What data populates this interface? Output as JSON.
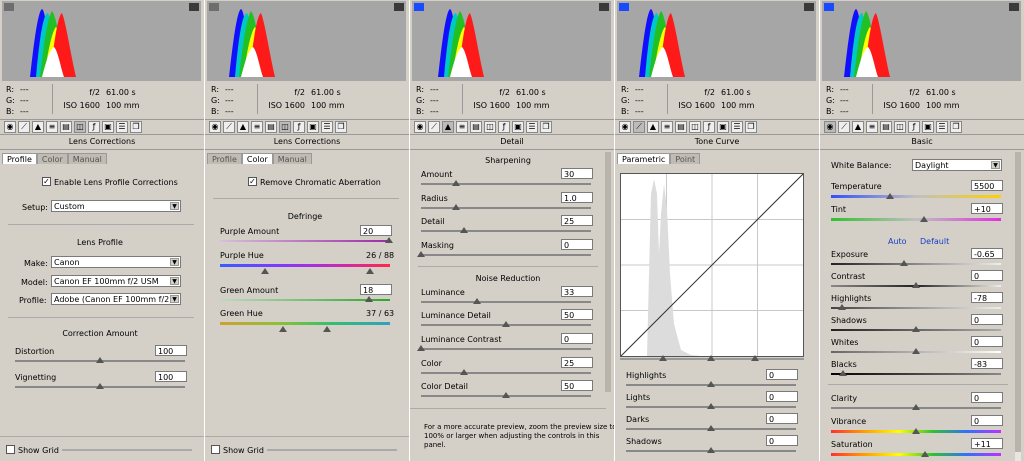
{
  "common": {
    "r_label": "R:",
    "g_label": "G:",
    "b_label": "B:",
    "dash": "---",
    "aperture": "f/2",
    "shutter": "61.00 s",
    "iso": "ISO 1600",
    "focal": "100 mm"
  },
  "lens_profile": {
    "title": "Lens Corrections",
    "tabs": [
      "Profile",
      "Color",
      "Manual"
    ],
    "enable_label": "Enable Lens Profile Corrections",
    "setup_label": "Setup:",
    "setup_value": "Custom",
    "section_lens_profile": "Lens Profile",
    "make_label": "Make:",
    "make_value": "Canon",
    "model_label": "Model:",
    "model_value": "Canon EF 100mm f/2 USM",
    "profile_label": "Profile:",
    "profile_value": "Adobe (Canon EF 100mm f/2 ...",
    "section_correction": "Correction Amount",
    "distortion_label": "Distortion",
    "distortion_value": "100",
    "vignetting_label": "Vignetting",
    "vignetting_value": "100",
    "show_grid": "Show Grid"
  },
  "lens_color": {
    "title": "Lens Corrections",
    "tabs": [
      "Profile",
      "Color",
      "Manual"
    ],
    "remove_ca_label": "Remove Chromatic Aberration",
    "section_defringe": "Defringe",
    "purple_amount_label": "Purple Amount",
    "purple_amount_value": "20",
    "purple_hue_label": "Purple Hue",
    "purple_hue_value": "26 / 88",
    "green_amount_label": "Green Amount",
    "green_amount_value": "18",
    "green_hue_label": "Green Hue",
    "green_hue_value": "37 / 63",
    "show_grid": "Show Grid"
  },
  "detail": {
    "title": "Detail",
    "section_sharpening": "Sharpening",
    "amount_label": "Amount",
    "amount_value": "30",
    "radius_label": "Radius",
    "radius_value": "1.0",
    "detail_label": "Detail",
    "detail_value": "25",
    "masking_label": "Masking",
    "masking_value": "0",
    "section_noise": "Noise Reduction",
    "luminance_label": "Luminance",
    "luminance_value": "33",
    "lum_detail_label": "Luminance Detail",
    "lum_detail_value": "50",
    "lum_contrast_label": "Luminance Contrast",
    "lum_contrast_value": "0",
    "color_label": "Color",
    "color_value": "25",
    "color_detail_label": "Color Detail",
    "color_detail_value": "50",
    "note_line1": "For a more accurate preview, zoom the preview size to",
    "note_line2": "100% or larger when adjusting the controls in this",
    "note_line3": "panel."
  },
  "tone_curve": {
    "title": "Tone Curve",
    "tabs": [
      "Parametric",
      "Point"
    ],
    "highlights_label": "Highlights",
    "highlights_value": "0",
    "lights_label": "Lights",
    "lights_value": "0",
    "darks_label": "Darks",
    "darks_value": "0",
    "shadows_label": "Shadows",
    "shadows_value": "0"
  },
  "basic": {
    "title": "Basic",
    "wb_label": "White Balance:",
    "wb_value": "Daylight",
    "temperature_label": "Temperature",
    "temperature_value": "5500",
    "tint_label": "Tint",
    "tint_value": "+10",
    "auto_label": "Auto",
    "default_label": "Default",
    "exposure_label": "Exposure",
    "exposure_value": "-0.65",
    "contrast_label": "Contrast",
    "contrast_value": "0",
    "highlights_label": "Highlights",
    "highlights_value": "-78",
    "shadows_label": "Shadows",
    "shadows_value": "0",
    "whites_label": "Whites",
    "whites_value": "0",
    "blacks_label": "Blacks",
    "blacks_value": "-83",
    "clarity_label": "Clarity",
    "clarity_value": "0",
    "vibrance_label": "Vibrance",
    "vibrance_value": "0",
    "saturation_label": "Saturation",
    "saturation_value": "+11"
  },
  "icons": [
    "camera-icon",
    "tone-curve-icon",
    "detail-icon",
    "hsl-icon",
    "split-toning-icon",
    "lens-corrections-icon",
    "fx-icon",
    "camera-calibration-icon",
    "presets-icon",
    "snapshots-icon"
  ]
}
